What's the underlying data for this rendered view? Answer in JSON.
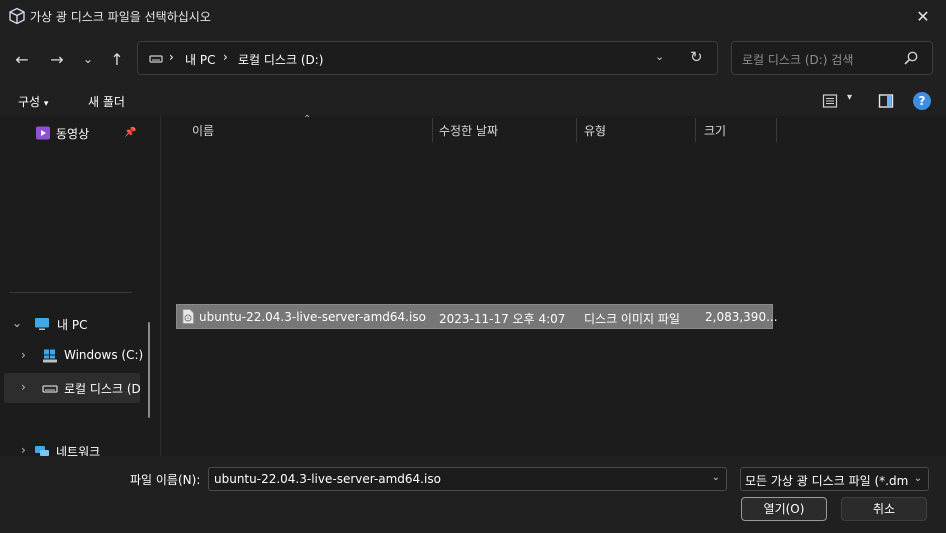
{
  "window": {
    "title": "가상 광 디스크 파일을 선택하십시오",
    "icon": "virtualbox-icon",
    "close_glyph": "✕"
  },
  "nav": {
    "back_glyph": "←",
    "forward_glyph": "→",
    "recent_glyph": "⌄",
    "up_glyph": "↑",
    "breadcrumb": [
      "내 PC",
      "로컬 디스크 (D:)"
    ],
    "sep_glyph": "›",
    "dropdown_glyph": "⌄",
    "refresh_glyph": "↻",
    "search_placeholder": "로컬 디스크 (D:) 검색"
  },
  "command_bar": {
    "organize": "구성",
    "organize_dd": "▾",
    "new_folder": "새 폴더",
    "view_dd": "▾",
    "help": "?"
  },
  "sidebar": {
    "items": [
      {
        "label": "동영상",
        "icon": "video-folder-icon",
        "pinned": true
      },
      {
        "label": "내 PC",
        "icon": "pc-icon",
        "expanded": true
      },
      {
        "label": "Windows (C:)",
        "icon": "windows-drive-icon"
      },
      {
        "label": "로컬 디스크 (D:)",
        "icon": "local-drive-icon",
        "selected": true
      },
      {
        "label": "네트워크",
        "icon": "network-icon"
      }
    ],
    "chevron_expanded": "⌄",
    "chevron_collapsed": "›",
    "pin_glyph": "📌"
  },
  "file_list": {
    "columns": [
      "이름",
      "수정한 날짜",
      "유형",
      "크기"
    ],
    "sort_glyph": "⌃",
    "rows": [
      {
        "name": "ubuntu-22.04.3-live-server-amd64.iso",
        "modified": "2023-11-17 오후 4:07",
        "type": "디스크 이미지 파일",
        "size": "2,083,390...",
        "selected": true
      }
    ]
  },
  "footer": {
    "filename_label": "파일 이름(N):",
    "filename_value": "ubuntu-22.04.3-live-server-amd64.iso",
    "filetype_value": "모든 가상 광 디스크 파일 (*.dmg *.iso *.cdr *.viso)",
    "dropdown_glyph": "⌄",
    "open_label": "열기(O)",
    "cancel_label": "취소"
  },
  "colors": {
    "accent": "#3a8fe0",
    "background": "#1c1c1c",
    "chrome": "#202020",
    "selection": "#777777"
  }
}
